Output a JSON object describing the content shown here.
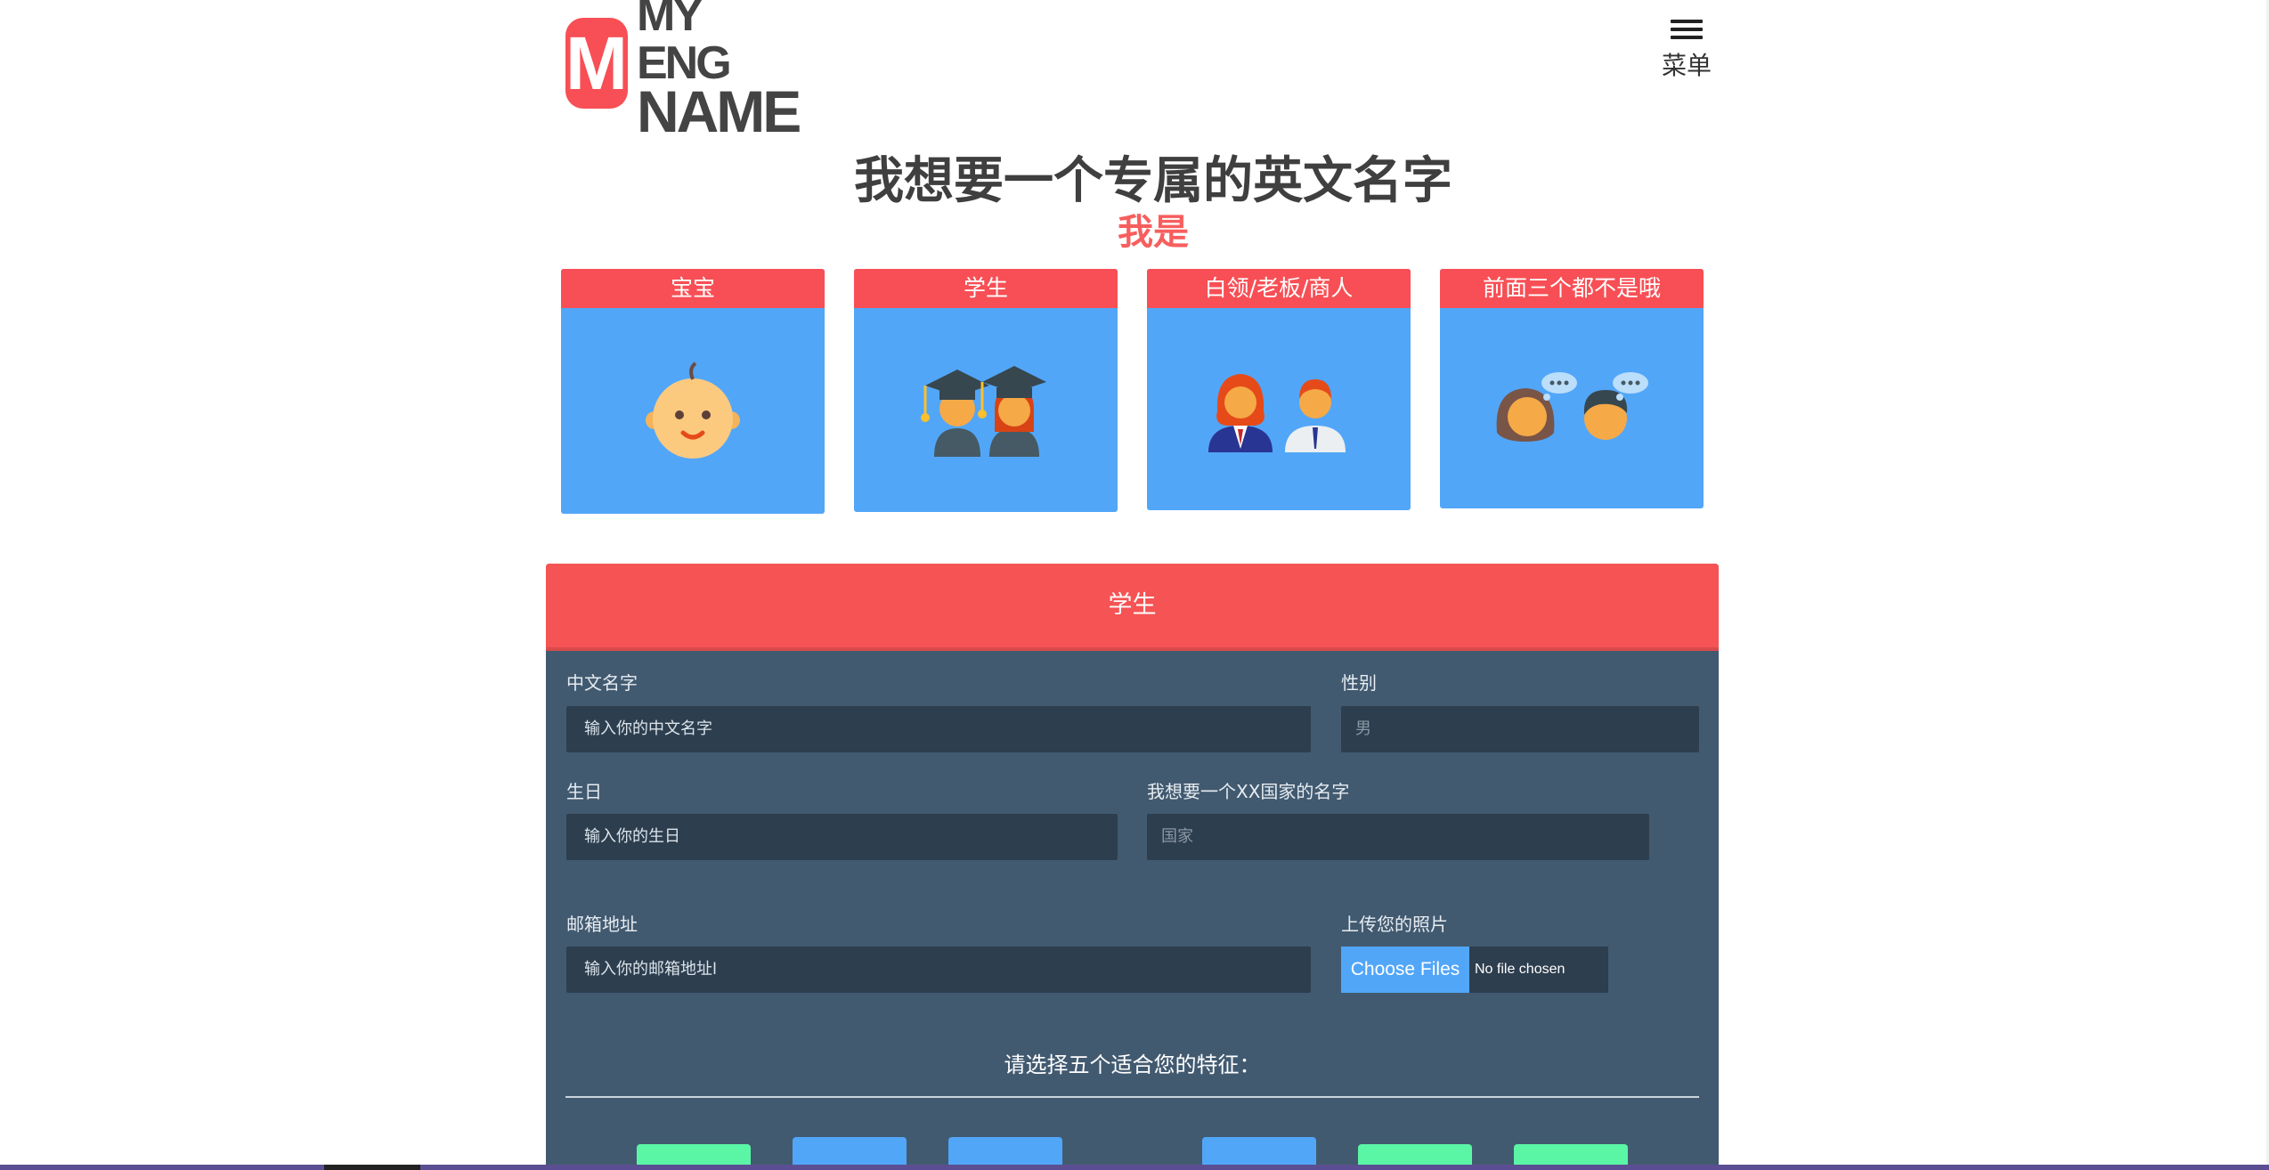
{
  "header": {
    "logo_letter": "M",
    "logo_line1": "MY ENG",
    "logo_line2": "NAME",
    "menu_label": "菜单"
  },
  "hero": {
    "title": "我想要一个专属的英文名字",
    "subtitle": "我是"
  },
  "categories": [
    {
      "label": "宝宝",
      "icon": "baby-icon"
    },
    {
      "label": "学生",
      "icon": "graduates-icon"
    },
    {
      "label": "白领/老板/商人",
      "icon": "office-workers-icon"
    },
    {
      "label": "前面三个都不是哦",
      "icon": "thinking-people-icon"
    }
  ],
  "form": {
    "title": "学生",
    "chinese_name": {
      "label": "中文名字",
      "value": "输入你的中文名字"
    },
    "gender": {
      "label": "性别",
      "placeholder": "男"
    },
    "birthday": {
      "label": "生日",
      "value": "输入你的生日"
    },
    "country": {
      "label": "我想要一个XX国家的名字",
      "placeholder": "国家"
    },
    "email": {
      "label": "邮箱地址",
      "value": "输入你的邮箱地址l"
    },
    "photo": {
      "label": "上传您的照片",
      "button": "Choose Files",
      "status": "No file chosen"
    },
    "traits_title": "请选择五个适合您的特征："
  },
  "colors": {
    "accent_red": "#f74f55",
    "card_blue": "#52a6f8",
    "panel": "#425a70",
    "input": "#2d3e4e",
    "chip_green": "#5bf6a5"
  }
}
